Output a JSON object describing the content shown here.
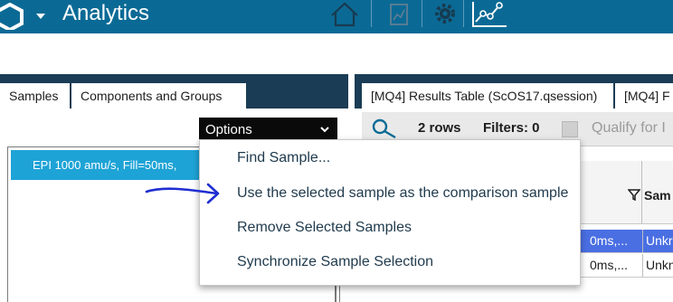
{
  "app": {
    "title": "Analytics",
    "logo_icon": "hexagon-logo-icon",
    "menu_caret_icon": "chevron-down-icon"
  },
  "toolbar_nav": {
    "icons": [
      "home-icon",
      "report-icon",
      "gear-icon",
      "trend-chart-icon"
    ]
  },
  "left_panel": {
    "tabs": [
      {
        "label": "Samples",
        "active": true
      },
      {
        "label": "Components and Groups",
        "active": false
      }
    ],
    "options_button": {
      "label": "Options",
      "icon": "chevron-down-icon"
    },
    "sample_list": {
      "selected_row": "EPI 1000 amu/s, Fill=50ms,"
    }
  },
  "options_menu": {
    "items": [
      "Find Sample...",
      "Use the selected sample as the comparison sample",
      "Remove Selected Samples",
      "Synchronize Sample Selection"
    ]
  },
  "right_panel": {
    "tabs": [
      {
        "label": "[MQ4] Results Table (ScOS17.qsession)"
      },
      {
        "label": "[MQ4] F"
      }
    ],
    "toolbar": {
      "rows_label": "2 rows",
      "filters_label": "Filters: 0",
      "qualify_label": "Qualify for I"
    },
    "table": {
      "header_partial": "Sam",
      "filter_icon": "filter-icon",
      "rows": [
        {
          "c1": "0ms,...",
          "c2": "Unkr",
          "highlight": true
        },
        {
          "c1": "0ms,...",
          "c2": "Unkn",
          "highlight": false
        }
      ]
    }
  },
  "colors": {
    "topbar": "#0b6a95",
    "panel_border": "#1b3c55",
    "selection": "#1ea3d6",
    "row_highlight": "#4a6fe3"
  }
}
